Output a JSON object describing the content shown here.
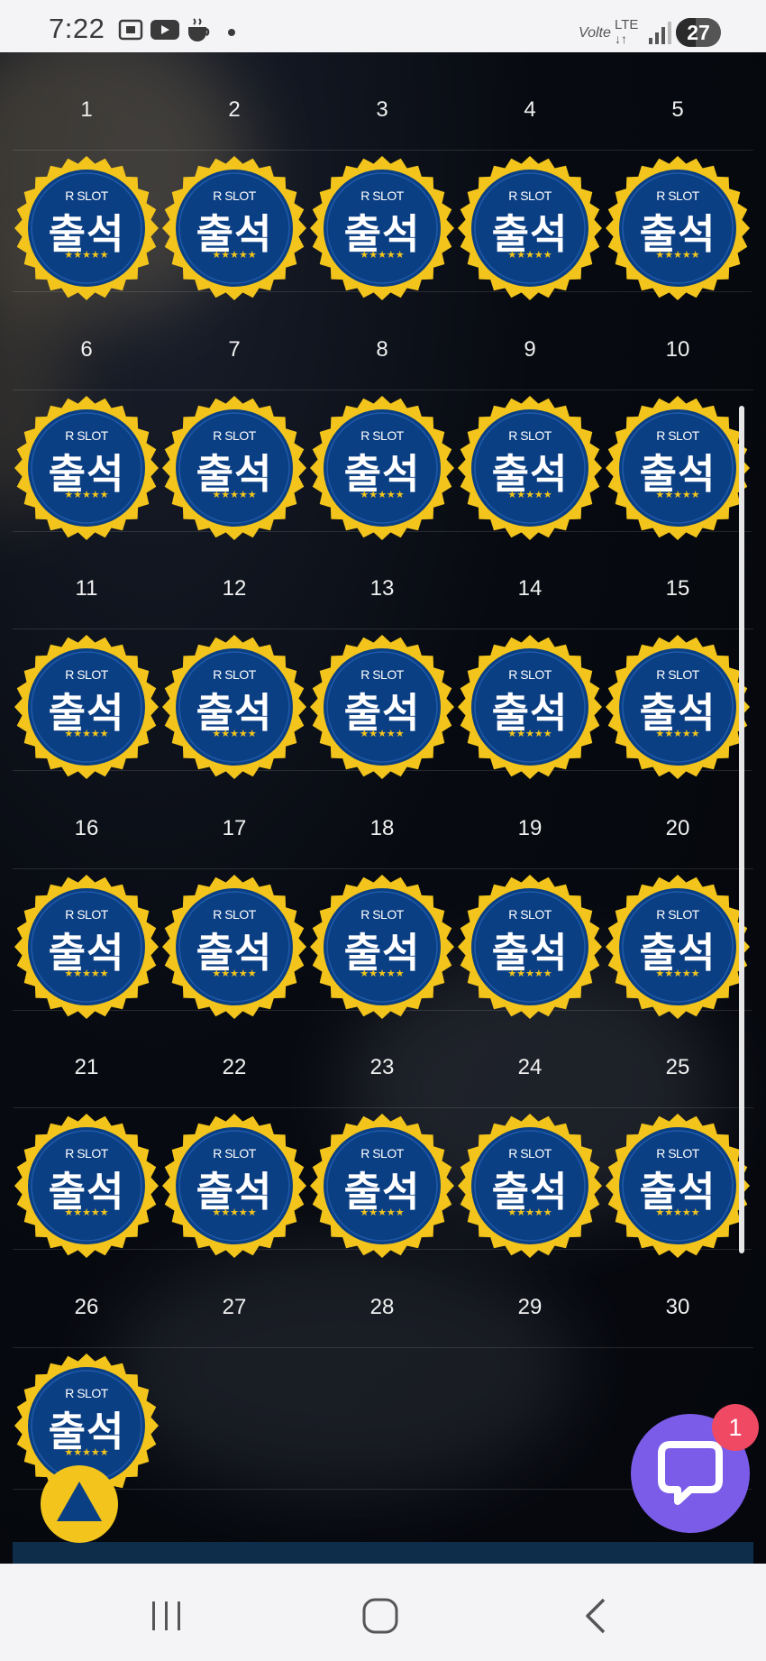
{
  "status_bar": {
    "time": "7:22",
    "left_icons": [
      "screenshot-icon",
      "youtube-icon",
      "coffee-icon",
      "dot-icon"
    ],
    "right_icons": [
      "volte-icon",
      "lte-data-icon",
      "signal-icon"
    ],
    "volte_label": "Volte",
    "lte_label": "LTE",
    "battery_level": "27"
  },
  "calendar": {
    "badge_brand": "R SLOT",
    "badge_word": "출석",
    "badge_stars": "★★★★★",
    "days": [
      {
        "day": "1",
        "checked": true
      },
      {
        "day": "2",
        "checked": true
      },
      {
        "day": "3",
        "checked": true
      },
      {
        "day": "4",
        "checked": true
      },
      {
        "day": "5",
        "checked": true
      },
      {
        "day": "6",
        "checked": true
      },
      {
        "day": "7",
        "checked": true
      },
      {
        "day": "8",
        "checked": true
      },
      {
        "day": "9",
        "checked": true
      },
      {
        "day": "10",
        "checked": true
      },
      {
        "day": "11",
        "checked": true
      },
      {
        "day": "12",
        "checked": true
      },
      {
        "day": "13",
        "checked": true
      },
      {
        "day": "14",
        "checked": true
      },
      {
        "day": "15",
        "checked": true
      },
      {
        "day": "16",
        "checked": true
      },
      {
        "day": "17",
        "checked": true
      },
      {
        "day": "18",
        "checked": true
      },
      {
        "day": "19",
        "checked": true
      },
      {
        "day": "20",
        "checked": true
      },
      {
        "day": "21",
        "checked": true
      },
      {
        "day": "22",
        "checked": true
      },
      {
        "day": "23",
        "checked": true
      },
      {
        "day": "24",
        "checked": true
      },
      {
        "day": "25",
        "checked": true
      },
      {
        "day": "26",
        "checked": true
      },
      {
        "day": "27",
        "checked": false
      },
      {
        "day": "28",
        "checked": false
      },
      {
        "day": "29",
        "checked": false
      },
      {
        "day": "30",
        "checked": false
      }
    ]
  },
  "chat": {
    "icon": "chat-bubble-icon",
    "unread_count": "1"
  },
  "scroll_top": {
    "icon": "triangle-up-icon"
  },
  "nav_bar": {
    "icons": [
      "recent-apps-icon",
      "home-icon",
      "back-icon"
    ]
  },
  "colors": {
    "badge_gold": "#f3c51c",
    "badge_blue": "#0b3f84",
    "chat_purple": "#7b5ce8",
    "chat_badge": "#ef4964"
  }
}
